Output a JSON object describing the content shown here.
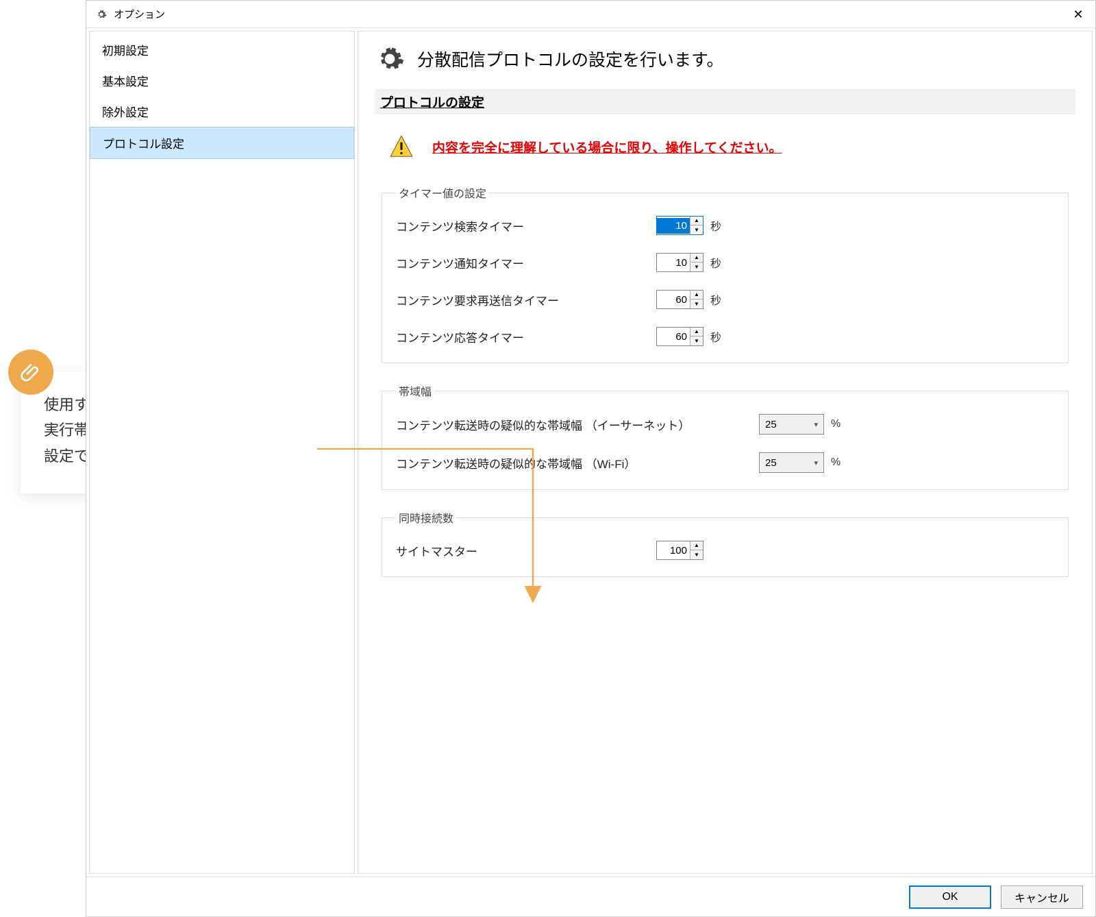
{
  "titlebar": {
    "title": "オプション"
  },
  "sidebar": {
    "items": [
      {
        "label": "初期設定"
      },
      {
        "label": "基本設定"
      },
      {
        "label": "除外設定"
      },
      {
        "label": "プロトコル設定"
      }
    ],
    "selected_index": 3
  },
  "main": {
    "heading": "分散配信プロトコルの設定を行います。",
    "section_title": "プロトコルの設定",
    "warning_text": "内容を完全に理解している場合に限り、操作してください。"
  },
  "timer_group": {
    "legend": "タイマー値の設定",
    "unit": "秒",
    "rows": [
      {
        "label": "コンテンツ検索タイマー",
        "value": "10",
        "focused": true
      },
      {
        "label": "コンテンツ通知タイマー",
        "value": "10"
      },
      {
        "label": "コンテンツ要求再送信タイマー",
        "value": "60"
      },
      {
        "label": "コンテンツ応答タイマー",
        "value": "60"
      }
    ]
  },
  "bandwidth_group": {
    "legend": "帯域幅",
    "unit": "%",
    "rows": [
      {
        "label": "コンテンツ転送時の疑似的な帯域幅 （イーサーネット）",
        "value": "25"
      },
      {
        "label": "コンテンツ転送時の疑似的な帯域幅 （Wi-Fi）",
        "value": "25"
      }
    ]
  },
  "conn_group": {
    "legend": "同時接続数",
    "rows": [
      {
        "label": "サイトマスター",
        "value": "100"
      }
    ]
  },
  "footer": {
    "ok": "OK",
    "cancel": "キャンセル"
  },
  "callout": {
    "line1": "使用する帯域幅を",
    "line2": "実行帯域に対する％指定で",
    "line3": "設定できます。"
  }
}
